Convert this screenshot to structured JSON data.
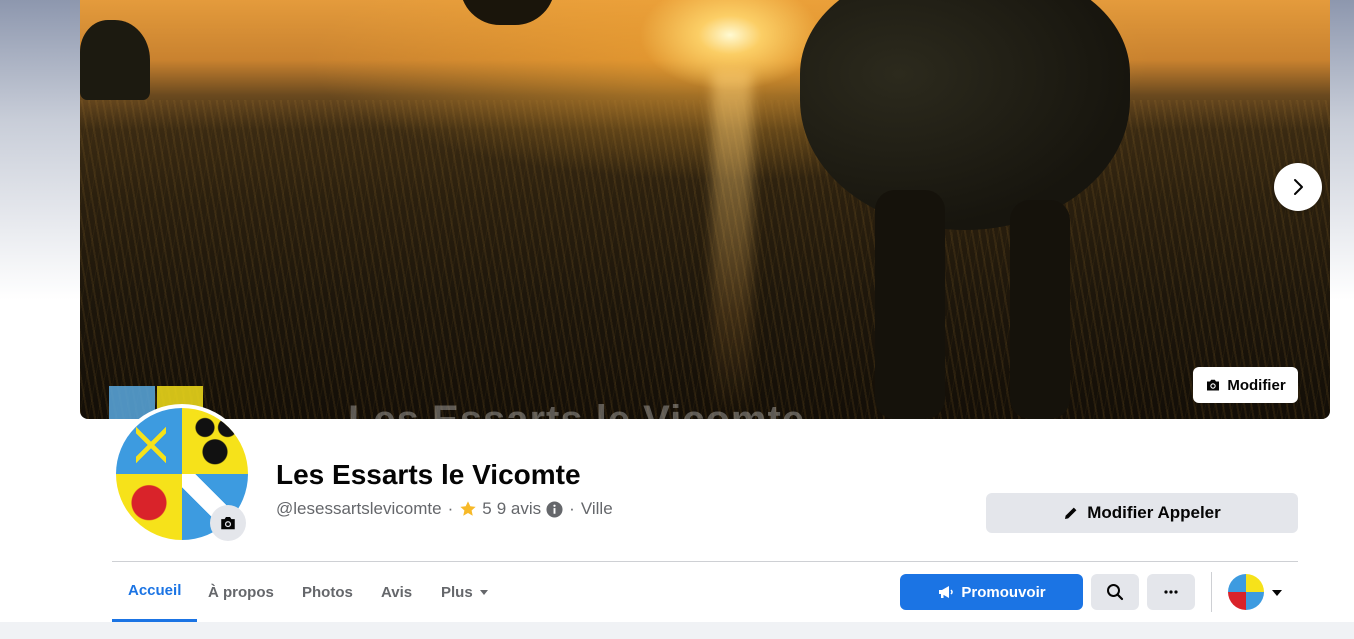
{
  "cover": {
    "overlay_text": "Les Essarts le Vicomte",
    "edit_label": "Modifier"
  },
  "profile": {
    "name": "Les Essarts le Vicomte",
    "handle": "@lesessartslevicomte",
    "rating": "5",
    "reviews": "9 avis",
    "category": "Ville",
    "separator": "·"
  },
  "actions": {
    "edit_call_label": "Modifier Appeler",
    "promote_label": "Promouvoir"
  },
  "tabs": [
    {
      "label": "Accueil",
      "active": true
    },
    {
      "label": "À propos",
      "active": false
    },
    {
      "label": "Photos",
      "active": false
    },
    {
      "label": "Avis",
      "active": false
    },
    {
      "label": "Plus",
      "active": false
    }
  ],
  "colors": {
    "accent": "#1b74e4",
    "button_bg": "#e4e6eb",
    "text": "#050505",
    "muted": "#65676b",
    "star": "#f7b928"
  },
  "icons": {
    "next": "chevron-right-icon",
    "camera": "camera-icon",
    "pencil": "pencil-icon",
    "megaphone": "megaphone-icon",
    "search": "search-icon",
    "more": "more-dots-icon",
    "caret": "caret-down-icon"
  }
}
